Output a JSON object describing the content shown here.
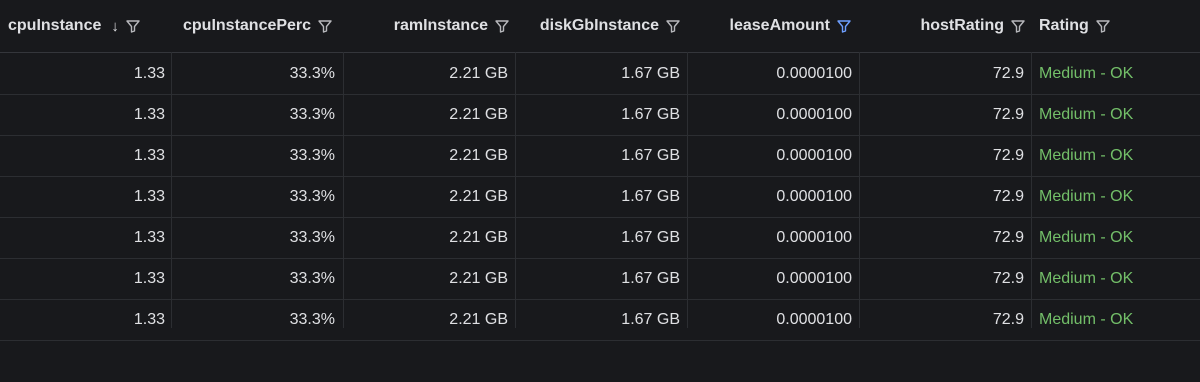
{
  "table": {
    "columns": [
      {
        "key": "cpuInstance",
        "label": "cpuInstance",
        "sorted": "desc",
        "filter_active": false
      },
      {
        "key": "cpuInstancePerc",
        "label": "cpuInstancePerc",
        "filter_active": false
      },
      {
        "key": "ramInstance",
        "label": "ramInstance",
        "filter_active": false
      },
      {
        "key": "diskGbInstance",
        "label": "diskGbInstance",
        "filter_active": false
      },
      {
        "key": "leaseAmount",
        "label": "leaseAmount",
        "filter_active": true
      },
      {
        "key": "hostRating",
        "label": "hostRating",
        "filter_active": false
      },
      {
        "key": "Rating",
        "label": "Rating",
        "filter_active": false
      }
    ],
    "sort_icon": "arrow-down-icon",
    "filter_icon": "funnel-icon",
    "colors": {
      "background": "#18191c",
      "text": "#dfe0e3",
      "rating_ok": "#73bf69",
      "filter_active": "#6e9fff"
    },
    "rows": [
      [
        "1.33",
        "33.3%",
        "2.21 GB",
        "1.67 GB",
        "0.0000100",
        "72.9",
        "Medium - OK"
      ],
      [
        "1.33",
        "33.3%",
        "2.21 GB",
        "1.67 GB",
        "0.0000100",
        "72.9",
        "Medium - OK"
      ],
      [
        "1.33",
        "33.3%",
        "2.21 GB",
        "1.67 GB",
        "0.0000100",
        "72.9",
        "Medium - OK"
      ],
      [
        "1.33",
        "33.3%",
        "2.21 GB",
        "1.67 GB",
        "0.0000100",
        "72.9",
        "Medium - OK"
      ],
      [
        "1.33",
        "33.3%",
        "2.21 GB",
        "1.67 GB",
        "0.0000100",
        "72.9",
        "Medium - OK"
      ],
      [
        "1.33",
        "33.3%",
        "2.21 GB",
        "1.67 GB",
        "0.0000100",
        "72.9",
        "Medium - OK"
      ],
      [
        "1.33",
        "33.3%",
        "2.21 GB",
        "1.67 GB",
        "0.0000100",
        "72.9",
        "Medium - OK"
      ]
    ]
  }
}
